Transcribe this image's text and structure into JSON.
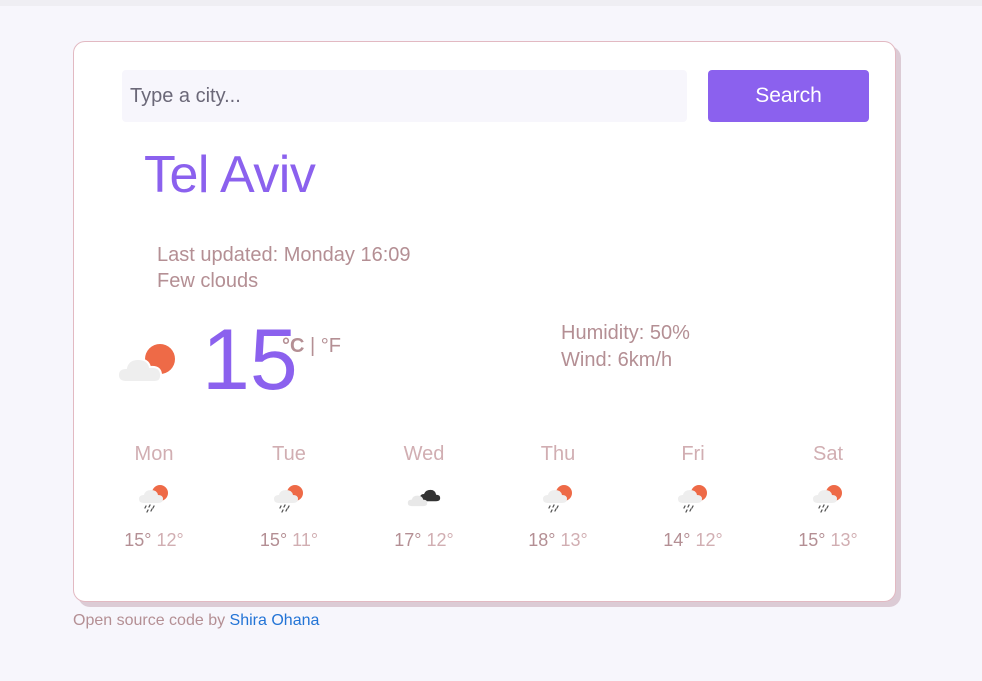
{
  "search": {
    "placeholder": "Type a city...",
    "button_label": "Search"
  },
  "current": {
    "city": "Tel Aviv",
    "last_updated": "Last updated: Monday 16:09",
    "description": "Few clouds",
    "temperature": "15",
    "unit_celsius": "°C",
    "unit_separator": " | ",
    "unit_fahrenheit": "°F",
    "humidity": "Humidity: 50%",
    "wind": "Wind: 6km/h",
    "icon": "few-clouds-day-icon"
  },
  "forecast": [
    {
      "day": "Mon",
      "max": "15°",
      "min": "12°",
      "icon": "rain-day-icon"
    },
    {
      "day": "Tue",
      "max": "15°",
      "min": "11°",
      "icon": "rain-day-icon"
    },
    {
      "day": "Wed",
      "max": "17°",
      "min": "12°",
      "icon": "broken-clouds-icon"
    },
    {
      "day": "Thu",
      "max": "18°",
      "min": "13°",
      "icon": "rain-day-icon"
    },
    {
      "day": "Fri",
      "max": "14°",
      "min": "12°",
      "icon": "rain-day-icon"
    },
    {
      "day": "Sat",
      "max": "15°",
      "min": "13°",
      "icon": "rain-day-icon"
    }
  ],
  "footer": {
    "prefix": "Open source code",
    "by": " by ",
    "author": "Shira Ohana"
  },
  "colors": {
    "accent": "#8b61ee",
    "text_muted": "#b48f94",
    "link": "#2374d6",
    "sun": "#ee6a47"
  }
}
